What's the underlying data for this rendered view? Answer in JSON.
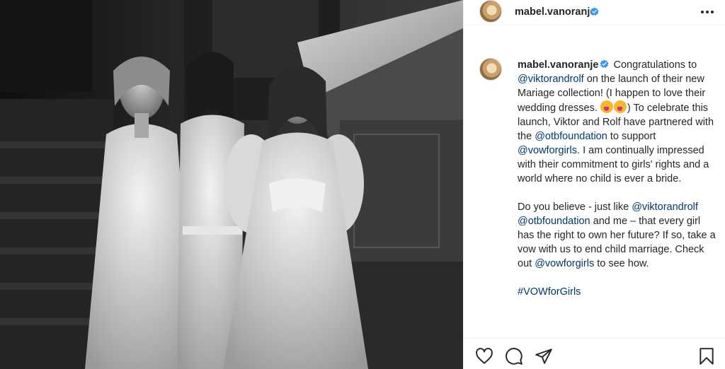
{
  "post": {
    "username": "mabel.vanoranje",
    "verified": true,
    "more_icon": "more-horizontal-icon"
  },
  "caption": {
    "username": "mabel.vanoranje",
    "p1_a": " Congratulations to ",
    "mention1": "@viktorandrolf",
    "p1_b": " on the launch of their new Mariage collection! (I happen to love their wedding dresses. ",
    "p1_c": ") To celebrate this launch, Viktor and Rolf have partnered with the ",
    "mention2": "@otbfoundation",
    "p1_d": " to support ",
    "mention3": "@vowforgirls",
    "p1_e": ". I am continually impressed with their commitment to girls' rights and a world where no child is ever a bride.",
    "p2_a": "Do you believe - just like ",
    "mention4": "@viktorandrolf",
    "p2_sp": " ",
    "mention5": "@otbfoundation",
    "p2_b": " and me – that every girl has the right to own her future? If so, take a vow with us to end child marriage. Check out ",
    "mention6": "@vowforgirls",
    "p2_c": " to see how.",
    "hashtag": "#VOWforGirls"
  },
  "actions": {
    "like_icon": "heart-icon",
    "comment_icon": "comment-icon",
    "share_icon": "share-icon",
    "save_icon": "bookmark-icon"
  },
  "colors": {
    "link": "#00376b",
    "verified": "#3897f0",
    "text": "#262626",
    "border": "#efefef"
  }
}
